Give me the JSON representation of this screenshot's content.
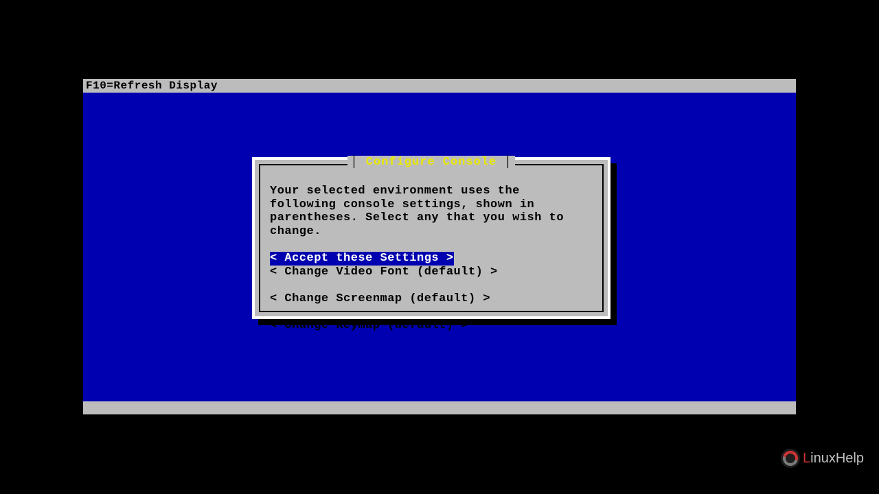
{
  "topbar": {
    "text": "F10=Refresh Display"
  },
  "dialog": {
    "title": "Configure Console",
    "description": "Your selected environment uses the following console settings, shown in parentheses. Select any that you wish to change.",
    "options": [
      {
        "label": "< Accept these Settings >",
        "selected": true
      },
      {
        "label": "< Change Video Font (default) >",
        "selected": false
      },
      {
        "label": "< Change Screenmap (default) >",
        "selected": false
      },
      {
        "label": "< Change Keymap (default) >",
        "selected": false
      }
    ]
  },
  "watermark": {
    "text_part1": "L",
    "text_part2": "inuxHelp"
  }
}
